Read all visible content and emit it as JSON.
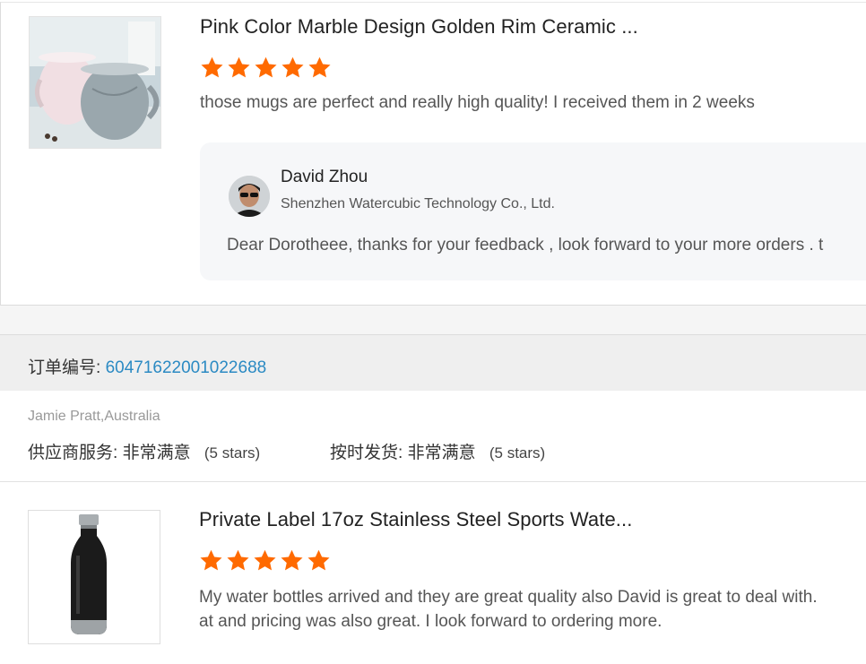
{
  "colors": {
    "star": "#ff6a00",
    "order_number": "#2b8ac3",
    "reply_bg": "#f6f7f9"
  },
  "review1": {
    "product_title": "Pink Color Marble Design Golden Rim Ceramic ...",
    "rating": 5,
    "text": "those mugs are perfect and really high quality! I received them in 2 weeks",
    "reply": {
      "name": "David Zhou",
      "company": "Shenzhen Watercubic Technology Co., Ltd.",
      "text": "Dear Dorotheee, thanks for your feedback , look forward to your more orders . t"
    }
  },
  "order": {
    "label": "订单编号:",
    "number": "6047162200102268 8",
    "buyer": "Jamie Pratt,Australia",
    "supplier_service_label": "供应商服务:",
    "supplier_service_value": "非常满意",
    "supplier_service_stars": "(5 stars)",
    "on_time_label": "按时发货:",
    "on_time_value": "非常满意",
    "on_time_stars": "(5 stars)"
  },
  "review2": {
    "product_title": "Private Label 17oz Stainless Steel Sports Wate...",
    "rating": 5,
    "text_line1": "My water bottles arrived and they are great quality also David is great to deal with.",
    "text_line2": "at and pricing was also great. I look forward to ordering more."
  }
}
